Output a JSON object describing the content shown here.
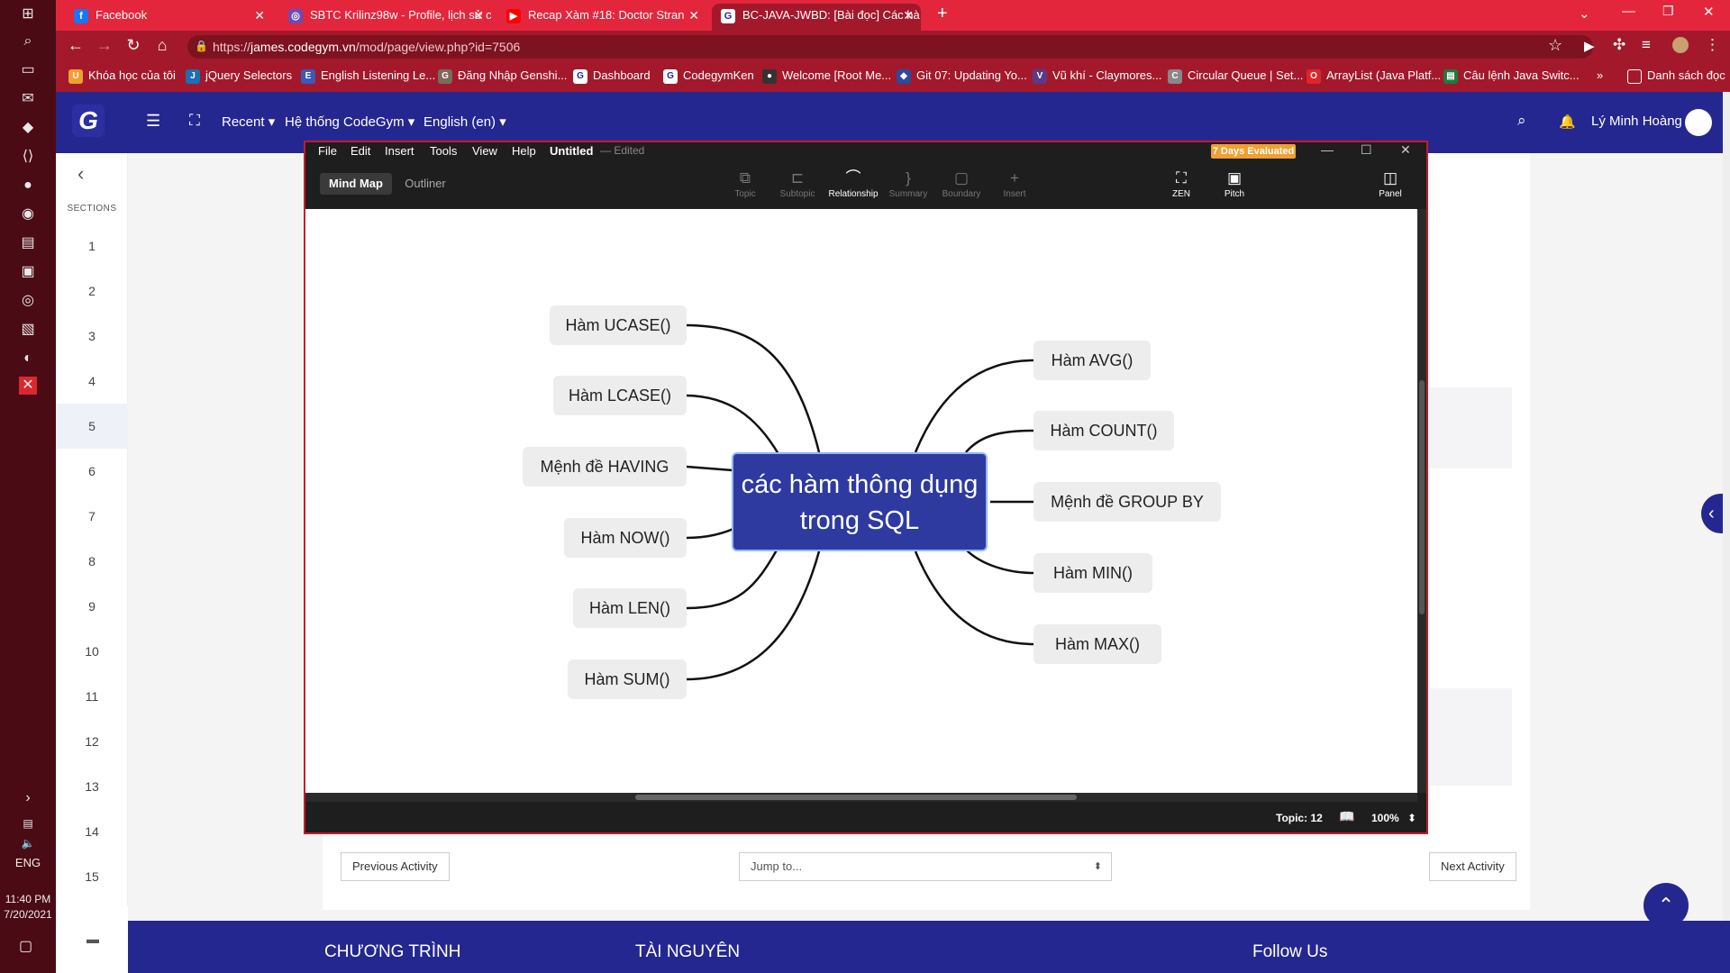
{
  "taskbar": {
    "lang": "ENG",
    "time": "11:40 PM",
    "date": "7/20/2021"
  },
  "browser": {
    "tabs": [
      {
        "title": "Facebook",
        "icon": "facebook-icon"
      },
      {
        "title": "SBTC Krilinz98w - Profile, lịch sử c",
        "icon": "profile-icon"
      },
      {
        "title": "Recap Xàm #18: Doctor Stran",
        "icon": "youtube-icon"
      },
      {
        "title": "BC-JAVA-JWBD: [Bài đọc] Các hà",
        "icon": "codegym-icon"
      }
    ],
    "url_prefix": "https://",
    "url_domain": "james.codegym.vn",
    "url_path": "/mod/page/view.php?id=7506",
    "bookmarks": [
      "Khóa học của tôi",
      "jQuery Selectors",
      "English Listening Le...",
      "Đăng Nhập Genshi...",
      "Dashboard",
      "CodegymKen",
      "Welcome [Root Me...",
      "Git 07: Updating Yo...",
      "Vũ khí - Claymores...",
      "Circular Queue | Set...",
      "ArrayList (Java Platf...",
      "Câu lệnh Java Switc..."
    ],
    "reading_list": "Danh sách đọc"
  },
  "moodle": {
    "nav": {
      "recent": "Recent",
      "system": "Hệ thống CodeGym",
      "lang": "English (en)",
      "user": "Lý Minh Hoàng"
    },
    "sections_label": "SECTIONS",
    "sections": [
      "1",
      "2",
      "3",
      "4",
      "5",
      "6",
      "7",
      "8",
      "9",
      "10",
      "11",
      "12",
      "13",
      "14",
      "15"
    ],
    "active_section": "5",
    "prev": "Previous Activity",
    "jump_placeholder": "Jump to...",
    "next": "Next Activity",
    "footer": {
      "col1": "CHƯƠNG TRÌNH",
      "col2": "TÀI NGUYÊN",
      "col3": "Follow Us"
    }
  },
  "xmind": {
    "menu": [
      "File",
      "Edit",
      "Insert",
      "Tools",
      "View",
      "Help"
    ],
    "doc_title": "Untitled",
    "doc_status": "— Edited",
    "eval_badge": "7 Days Evaluated",
    "view_tabs": [
      "Mind Map",
      "Outliner"
    ],
    "tools": [
      "Topic",
      "Subtopic",
      "Relationship",
      "Summary",
      "Boundary",
      "Insert"
    ],
    "right_tools": [
      "ZEN",
      "Pitch",
      "Panel"
    ],
    "status_topics": "Topic: 12",
    "zoom": "100%"
  },
  "mindmap": {
    "central": "các hàm thông dụng trong SQL",
    "left": [
      "Hàm UCASE()",
      "Hàm LCASE()",
      "Mệnh đề HAVING",
      "Hàm NOW()",
      "Hàm LEN()",
      "Hàm SUM()"
    ],
    "right": [
      "Hàm AVG()",
      "Hàm COUNT()",
      "Mệnh đề GROUP BY",
      "Hàm MIN()",
      "Hàm MAX()"
    ]
  },
  "colors": {
    "brand_red": "#e4263c",
    "navy": "#24278f",
    "central_node": "#2e3aa0"
  }
}
